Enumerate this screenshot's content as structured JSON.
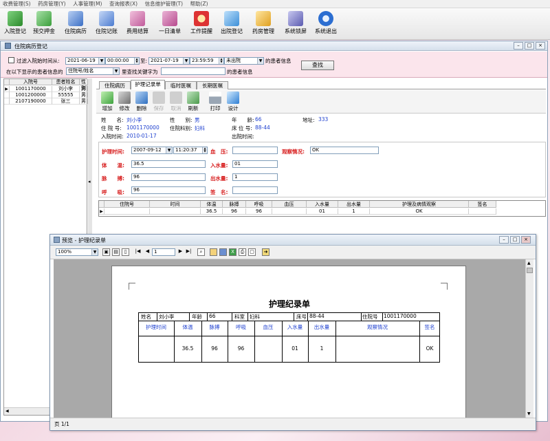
{
  "menu": [
    "收费管理(S)",
    "药房管理(Y)",
    "人事管理(M)",
    "查询报表(X)",
    "信息维护管理(T)",
    "帮助(Z)"
  ],
  "toolbar": [
    {
      "label": "入院登记",
      "icon": "register-icon",
      "color": "#2b8a2b"
    },
    {
      "label": "预交押金",
      "icon": "deposit-icon",
      "color": "#3a9e3a"
    },
    {
      "label": "住院病历",
      "icon": "medical-record-icon",
      "color": "#3b6fc5"
    },
    {
      "label": "住院记账",
      "icon": "ledger-icon",
      "color": "#4b7bd0"
    },
    {
      "label": "费用结算",
      "icon": "settlement-icon",
      "color": "#c05a9a"
    },
    {
      "label": "一日清单",
      "icon": "daily-list-icon",
      "color": "#b74a8e"
    },
    {
      "label": "工作提醒",
      "icon": "alarm-clock-icon",
      "color": "#d33"
    },
    {
      "label": "出院登记",
      "icon": "discharge-icon",
      "color": "#3c8fd8"
    },
    {
      "label": "药房管理",
      "icon": "pharmacy-icon",
      "color": "#e0a020"
    },
    {
      "label": "系统锁屏",
      "icon": "lock-screen-icon",
      "color": "#5a5ab0"
    },
    {
      "label": "系统退出",
      "icon": "exit-icon",
      "color": "#2c6ed1"
    }
  ],
  "main_window": {
    "title": "住院病历登记"
  },
  "filter": {
    "checkbox_label": "过滤入院始时间从:",
    "date_from": "2021-06-19",
    "time_from": "00:00:00",
    "to_label": "至:",
    "date_to": "2021-07-19",
    "time_to": "23:59:59",
    "status_value": "未出院",
    "status_suffix": "的患者信息",
    "search_button": "查找",
    "row2_prefix": "在以下显示的患者信息的",
    "field_select": "住院号/姓名",
    "row2_mid": "里查找关键字为",
    "keyword": "",
    "row2_suffix": "的患者信息"
  },
  "patient_list": {
    "headers": [
      "入院号",
      "患者姓名",
      "性别"
    ],
    "rows": [
      [
        "1001170000",
        "刘小李",
        "男"
      ],
      [
        "1001200000",
        "55555",
        "男"
      ],
      [
        "2107190000",
        "张三",
        "男"
      ]
    ]
  },
  "tabs": [
    "住院病历",
    "护理记录单",
    "临时医嘱",
    "长期医嘱"
  ],
  "actions": [
    {
      "label": "增加",
      "icon": "add-icon",
      "enabled": true
    },
    {
      "label": "修改",
      "icon": "edit-icon",
      "enabled": true
    },
    {
      "label": "删除",
      "icon": "delete-icon",
      "enabled": true
    },
    {
      "label": "保存",
      "icon": "save-icon",
      "enabled": false
    },
    {
      "label": "取消",
      "icon": "cancel-icon",
      "enabled": false
    },
    {
      "label": "刷新",
      "icon": "refresh-icon",
      "enabled": true
    },
    {
      "label": "打印",
      "icon": "print-icon",
      "enabled": true
    },
    {
      "label": "设计",
      "icon": "design-icon",
      "enabled": true
    }
  ],
  "patient": {
    "name_label": "姓　　名:",
    "name": "刘小李",
    "gender_label": "性　　别:",
    "gender": "男",
    "age_label": "年　　龄:",
    "age": "66",
    "address_label": "地址:",
    "address": "333",
    "inpatient_no_label": "住 院 号:",
    "inpatient_no": "1001170000",
    "dept_label": "住院科别:",
    "dept": "妇科",
    "bed_label": "床 位 号:",
    "bed": "88-44",
    "admit_label": "入院时间:",
    "admit_date": "2010-01-17",
    "discharge_label": "出院时间:",
    "discharge_date": ""
  },
  "nursing_form": {
    "time_label": "护理时间:",
    "date": "2007-09-12",
    "time": "11:20:37",
    "bp_label": "血　压:",
    "bp": "",
    "obs_label": "观察情况:",
    "obs": "OK",
    "temp_label": "体　　温:",
    "temp": "36.5",
    "intake_label": "入水量:",
    "intake": "01",
    "pulse_label": "脉　　搏:",
    "pulse": "96",
    "output_label": "出水量:",
    "output": "1",
    "resp_label": "呼　　吸:",
    "resp": "96",
    "sign_label": "签　名:",
    "sign": ""
  },
  "nursing_grid": {
    "headers": [
      "住院号",
      "时间",
      "体温",
      "脉搏",
      "呼吸",
      "血压",
      "入水量",
      "出水量",
      "护理及病情观察",
      "签名"
    ],
    "row": [
      "",
      "",
      "36.5",
      "96",
      "96",
      "",
      "01",
      "1",
      "OK",
      ""
    ]
  },
  "preview": {
    "title": "预览 - 护理纪录单",
    "zoom": "100%",
    "page_input": "1",
    "status": "页 1/1",
    "report": {
      "title": "护理纪录单",
      "name_label": "姓名",
      "name": "刘小李",
      "age_label": "年龄",
      "age": "66",
      "dept_label": "科室",
      "dept": "妇科",
      "bed_label": "床号",
      "bed": "88-44",
      "no_label": "住院号",
      "no": "1001170000",
      "headers": [
        "护理时间",
        "体温",
        "脉搏",
        "呼吸",
        "血压",
        "入水量",
        "出水量",
        "观察情况",
        "签名"
      ],
      "row": [
        "",
        "36.5",
        "96",
        "96",
        "",
        "01",
        "1",
        "",
        "OK"
      ]
    }
  }
}
